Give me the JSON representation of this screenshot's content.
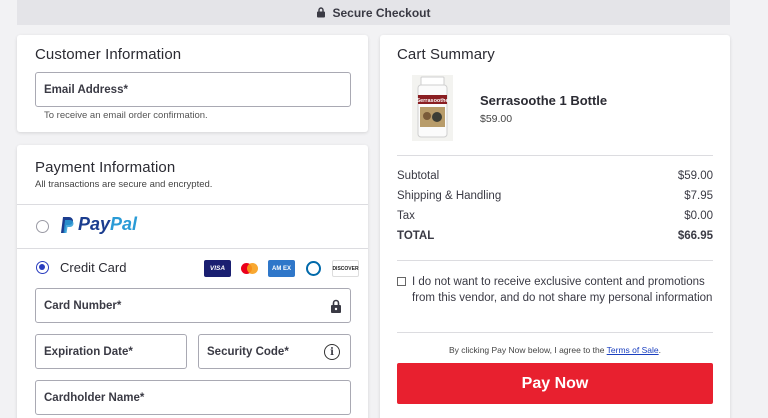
{
  "header": {
    "label": "Secure Checkout"
  },
  "customer": {
    "title": "Customer Information",
    "email_placeholder": "Email Address*",
    "email_hint": "To receive an email order confirmation."
  },
  "payment": {
    "title": "Payment Information",
    "subtitle": "All transactions are secure and encrypted.",
    "paypal_word1": "Pay",
    "paypal_word2": "Pal",
    "credit_card_label": "Credit Card",
    "card_logos": {
      "visa": "VISA",
      "amex": "AM EX",
      "discover": "DISCOVER"
    },
    "card_number_placeholder": "Card Number*",
    "expiration_placeholder": "Expiration Date*",
    "security_placeholder": "Security Code*",
    "cardholder_placeholder": "Cardholder Name*",
    "selected_method": "credit-card"
  },
  "cart": {
    "title": "Cart Summary",
    "product": {
      "name": "Serrasoothe 1 Bottle",
      "price": "$59.00",
      "image_icon": "product-bottle-image",
      "label_text": "Serrasoothe"
    },
    "lines": [
      {
        "label": "Subtotal",
        "value": "$59.00"
      },
      {
        "label": "Shipping & Handling",
        "value": "$7.95"
      },
      {
        "label": "Tax",
        "value": "$0.00"
      }
    ],
    "total": {
      "label": "TOTAL",
      "value": "$66.95"
    },
    "optin_text": "I do not want to receive exclusive content and promotions from this vendor, and do not share my personal information",
    "terms_prefix": "By clicking Pay Now below, I agree to the ",
    "terms_link": "Terms of Sale",
    "terms_suffix": ".",
    "pay_button": "Pay Now"
  },
  "colors": {
    "accent": "#e8202f",
    "radio": "#2a3dbf",
    "paypal_dark": "#1b3d8f",
    "paypal_light": "#2a9bd6"
  }
}
